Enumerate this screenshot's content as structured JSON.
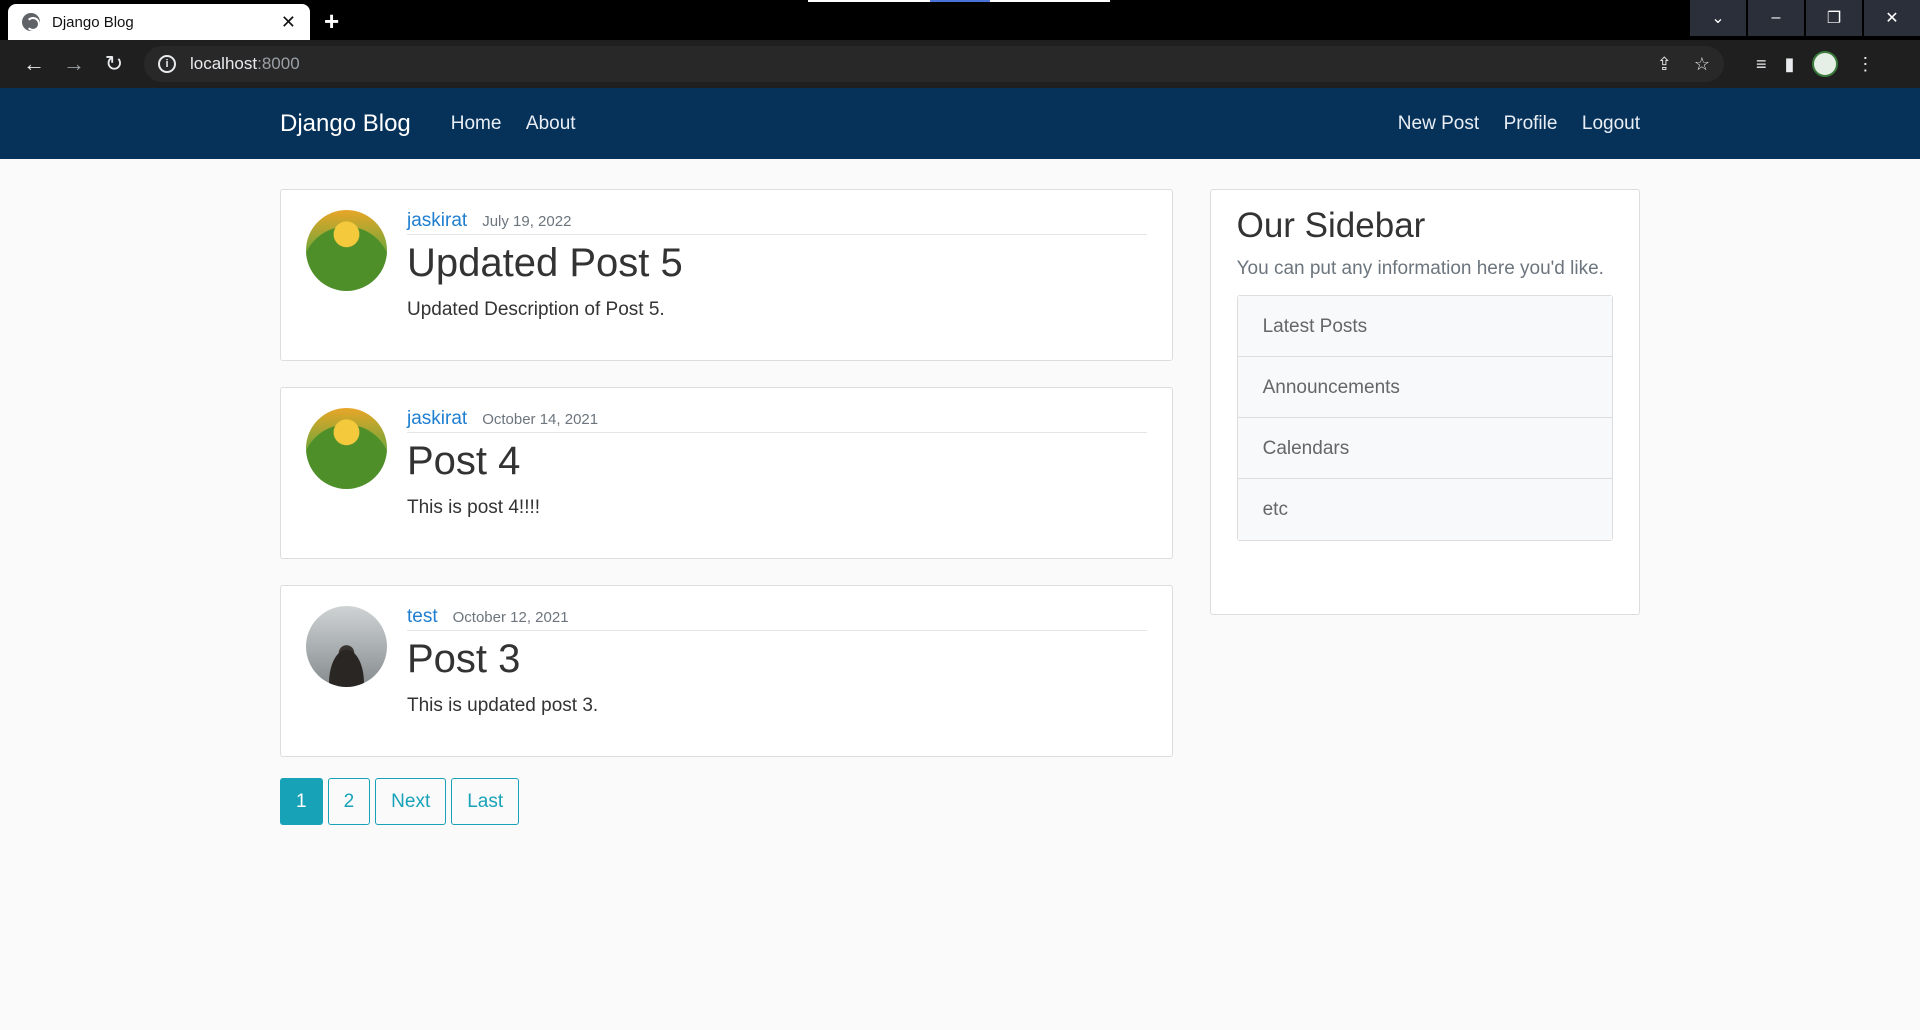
{
  "browser": {
    "tab_title": "Django Blog",
    "tab_close": "✕",
    "new_tab": "+",
    "url_host": "localhost",
    "url_port": ":8000",
    "window_controls": [
      "⌄",
      "–",
      "❐",
      "✕"
    ]
  },
  "navbar": {
    "brand": "Django Blog",
    "links": [
      "Home",
      "About"
    ],
    "right_links": [
      "New Post",
      "Profile",
      "Logout"
    ],
    "bg_color": "#06325a"
  },
  "posts": [
    {
      "author": "jaskirat",
      "date": "July 19, 2022",
      "title": "Updated Post 5",
      "content": "Updated Description of Post 5.",
      "avatar": "pikachu-avatar"
    },
    {
      "author": "jaskirat",
      "date": "October 14, 2021",
      "title": "Post 4",
      "content": "This is post 4!!!!",
      "avatar": "pikachu-avatar"
    },
    {
      "author": "test",
      "date": "October 12, 2021",
      "title": "Post 3",
      "content": "This is updated post 3.",
      "avatar": "landscape-avatar"
    }
  ],
  "pagination": {
    "items": [
      "1",
      "2",
      "Next",
      "Last"
    ],
    "active": "1",
    "color": "#17a2b8"
  },
  "sidebar": {
    "title": "Our Sidebar",
    "text": "You can put any information here you'd like.",
    "items": [
      "Latest Posts",
      "Announcements",
      "Calendars",
      "etc"
    ]
  }
}
